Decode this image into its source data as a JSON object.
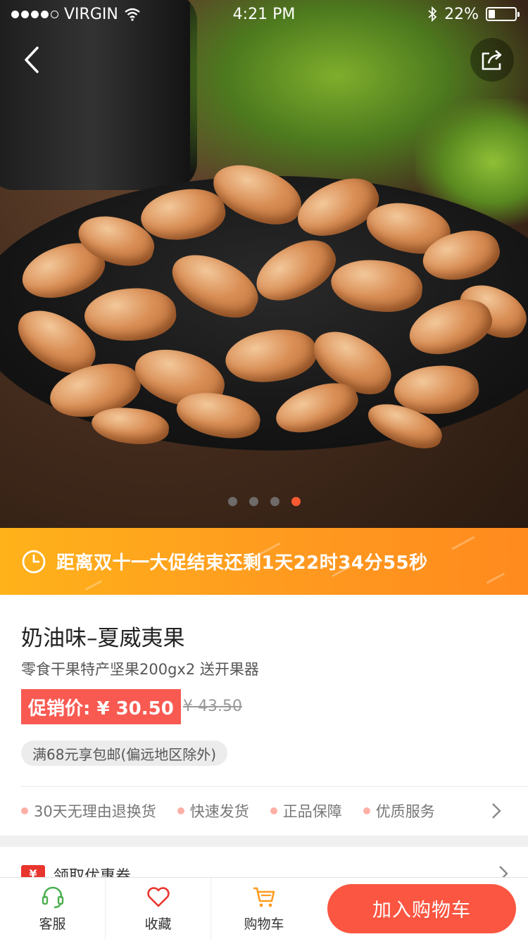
{
  "status_bar": {
    "carrier": "VIRGIN",
    "time": "4:21 PM",
    "battery": "22%",
    "battery_level": 0.22,
    "signal_bars": 4
  },
  "hero": {
    "image_icon": "cashew-nuts-photo",
    "page_count": 4,
    "active_page_index": 3
  },
  "nav": {
    "back_icon": "chevron-left-icon",
    "share_icon": "share-icon"
  },
  "promo": {
    "icon": "clock-icon",
    "countdown_text": "距离双十一大促结束还剩1天22时34分55秒"
  },
  "product": {
    "title": "奶油味–夏威夷果",
    "subtitle": "零食干果特产坚果200gx2 送开果器",
    "promo_price_label": "促销价: ¥ 30.50",
    "original_price": "¥ 43.50",
    "shipping_badge": "满68元享包邮(偏远地区除外)"
  },
  "guarantees": [
    "30天无理由退换货",
    "快速发货",
    "正品保障",
    "优质服务"
  ],
  "coupon": {
    "icon_text": "¥",
    "label": "领取优惠券"
  },
  "bottom_bar": {
    "tabs": [
      {
        "label": "客服",
        "icon": "headset-icon"
      },
      {
        "label": "收藏",
        "icon": "heart-icon"
      },
      {
        "label": "购物车",
        "icon": "cart-icon"
      }
    ],
    "add_to_cart": "加入购物车"
  },
  "colors": {
    "accent": "#fa5641",
    "promo_orange": "#ff9c1f",
    "price_red": "#f85a52",
    "active_dot": "#ff5a32"
  }
}
